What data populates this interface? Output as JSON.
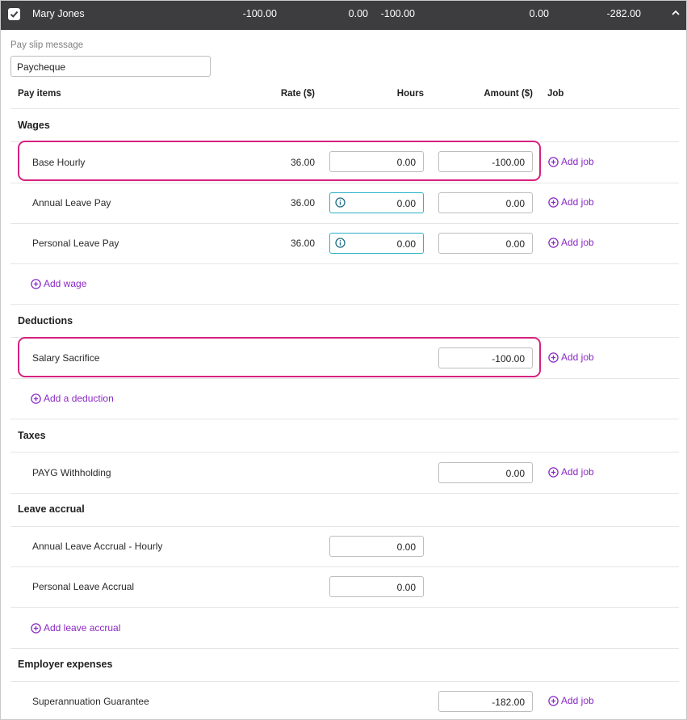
{
  "header": {
    "employee_name": "Mary Jones",
    "values": [
      "-100.00",
      "0.00",
      "-100.00",
      "0.00",
      "-282.00"
    ],
    "checked": true
  },
  "pay_slip": {
    "label": "Pay slip message",
    "value": "Paycheque"
  },
  "columns": {
    "pay_items": "Pay items",
    "rate": "Rate ($)",
    "hours": "Hours",
    "amount": "Amount ($)",
    "job": "Job"
  },
  "add_job_label": "Add job",
  "wages": {
    "title": "Wages",
    "rows": [
      {
        "label": "Base Hourly",
        "rate": "36.00",
        "hours": "0.00",
        "amount": "-100.00"
      },
      {
        "label": "Annual Leave Pay",
        "rate": "36.00",
        "hours": "0.00",
        "amount": "0.00"
      },
      {
        "label": "Personal Leave Pay",
        "rate": "36.00",
        "hours": "0.00",
        "amount": "0.00"
      }
    ],
    "add_label": "Add wage"
  },
  "deductions": {
    "title": "Deductions",
    "rows": [
      {
        "label": "Salary Sacrifice",
        "amount": "-100.00"
      }
    ],
    "add_label": "Add a deduction"
  },
  "taxes": {
    "title": "Taxes",
    "rows": [
      {
        "label": "PAYG Withholding",
        "amount": "0.00"
      }
    ]
  },
  "leave_accrual": {
    "title": "Leave accrual",
    "rows": [
      {
        "label": "Annual Leave Accrual - Hourly",
        "hours": "0.00"
      },
      {
        "label": "Personal Leave Accrual",
        "hours": "0.00"
      }
    ],
    "add_label": "Add leave accrual"
  },
  "employer_expenses": {
    "title": "Employer expenses",
    "rows": [
      {
        "label": "Superannuation Guarantee",
        "amount": "-182.00"
      }
    ]
  },
  "colors": {
    "header_bg": "#3d3d40",
    "link": "#8a29c4",
    "highlight": "#d6237f",
    "info_border": "#2bb2c7"
  }
}
